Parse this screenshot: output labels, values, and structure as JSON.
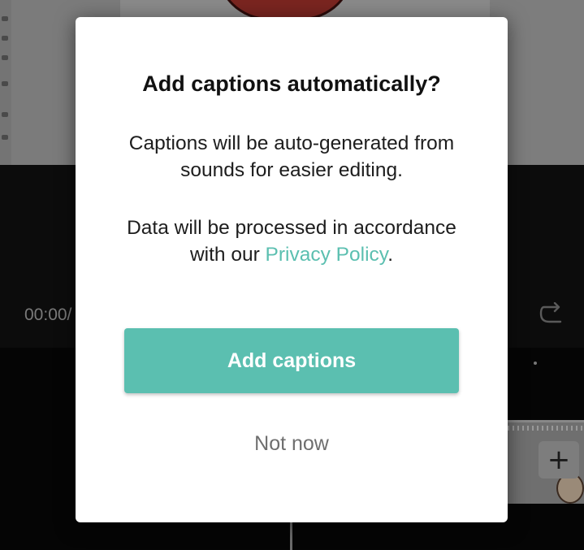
{
  "background": {
    "time_readout": "00:00/",
    "redo_icon": "redo-icon",
    "add_clip_icon": "plus-icon",
    "add_clip_label": "+"
  },
  "dialog": {
    "title": "Add captions automatically?",
    "description": "Captions will be auto-generated from sounds for easier editing.",
    "privacy_prefix": "Data will be processed in accordance with our ",
    "privacy_link": "Privacy Policy",
    "privacy_suffix": ".",
    "primary_button": "Add captions",
    "secondary_button": "Not now"
  },
  "colors": {
    "accent": "#5bbfb0",
    "dialog_background": "#ffffff",
    "secondary_text": "#6e6e6e"
  }
}
